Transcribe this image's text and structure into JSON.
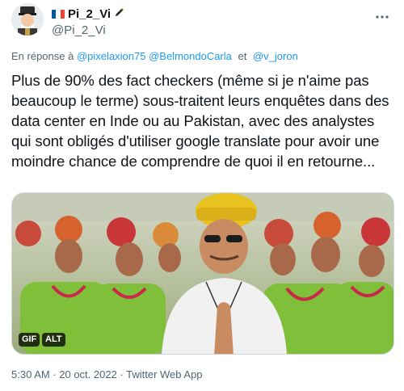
{
  "author": {
    "display_name": "Pi_2_Vi",
    "handle": "@Pi_2_Vi",
    "flag": "france-flag-icon",
    "badge_icon": "pen-icon"
  },
  "reply": {
    "prefix": "En réponse à",
    "mentions": [
      "@pixelaxion75",
      "@BelmondoCarla"
    ],
    "conjunction": "et",
    "last_mention": "@v_joron"
  },
  "tweet": {
    "text": "Plus de 90% des fact checkers (même si je n'aime pas beaucoup le terme) sous-traitent leurs enquêtes dans des data center en Inde ou au Pakistan, avec des analystes qui sont obligés d'utiliser google translate pour avoir une moindre chance de comprendre de quoi il en retourne..."
  },
  "media": {
    "gif_label": "GIF",
    "alt_label": "ALT"
  },
  "meta": {
    "text": "5:30 AM · 20 oct. 2022 · Twitter Web App"
  },
  "colors": {
    "link": "#1d9bf0",
    "secondary_text": "#536471",
    "primary_text": "#0f1419"
  }
}
